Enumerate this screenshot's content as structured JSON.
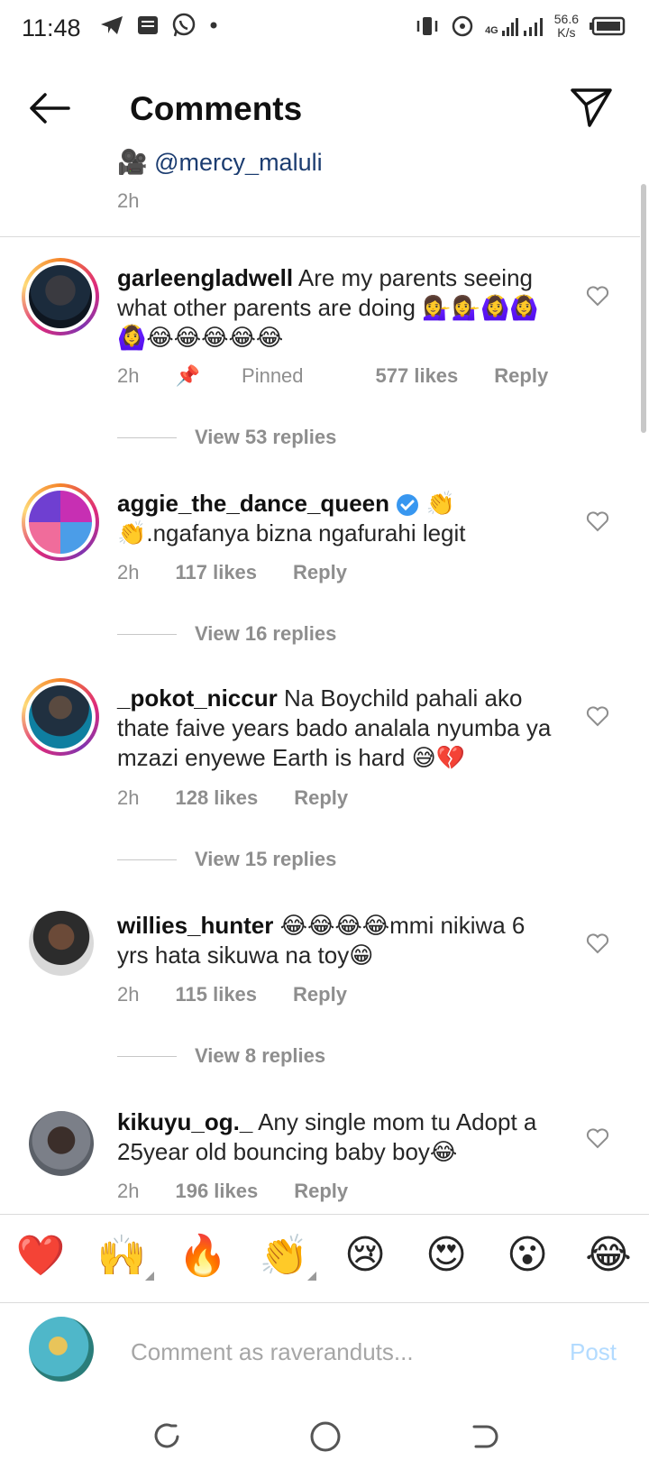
{
  "status_bar": {
    "time": "11:48",
    "net_speed_value": "56.6",
    "net_speed_unit": "K/s",
    "network_label": "4G"
  },
  "header": {
    "title": "Comments"
  },
  "caption": {
    "mention": "@mercy_maluli",
    "time": "2h"
  },
  "comments": [
    {
      "username": "garleengladwell",
      "text": "Are my parents seeing what other parents are doing 💁‍♀️💁‍♀️🙆‍♀️🙆‍♀️🙆‍♀️😂😂😂😂😂",
      "time": "2h",
      "pinned": "Pinned",
      "likes": "577 likes",
      "reply": "Reply",
      "view_replies": "View 53 replies"
    },
    {
      "username": "aggie_the_dance_queen",
      "text": "👏 👏.ngafanya bizna ngafurahi legit",
      "time": "2h",
      "likes": "117 likes",
      "reply": "Reply",
      "view_replies": "View 16 replies"
    },
    {
      "username": "_pokot_niccur",
      "text": "Na Boychild pahali ako thate faive years bado analala nyumba ya mzazi enyewe Earth is hard 😅💔",
      "time": "2h",
      "likes": "128 likes",
      "reply": "Reply",
      "view_replies": "View 15 replies"
    },
    {
      "username": "willies_hunter",
      "text": "😂😂😂😂mmi nikiwa 6 yrs hata sikuwa na toy😁",
      "time": "2h",
      "likes": "115 likes",
      "reply": "Reply",
      "view_replies": "View 8 replies"
    },
    {
      "username": "kikuyu_og._",
      "text": "Any single mom tu Adopt a 25year old bouncing baby boy😂",
      "time": "2h",
      "likes": "196 likes",
      "reply": "Reply"
    }
  ],
  "reactions": [
    "❤️",
    "🙌",
    "🔥",
    "👏",
    "😢",
    "😍",
    "😮",
    "😂"
  ],
  "composer": {
    "placeholder": "Comment as raveranduts...",
    "post_label": "Post"
  },
  "colors": {
    "accent_blue": "#3897f0",
    "post_disabled": "#b3dbff",
    "muted_text": "#8e8e8e"
  }
}
